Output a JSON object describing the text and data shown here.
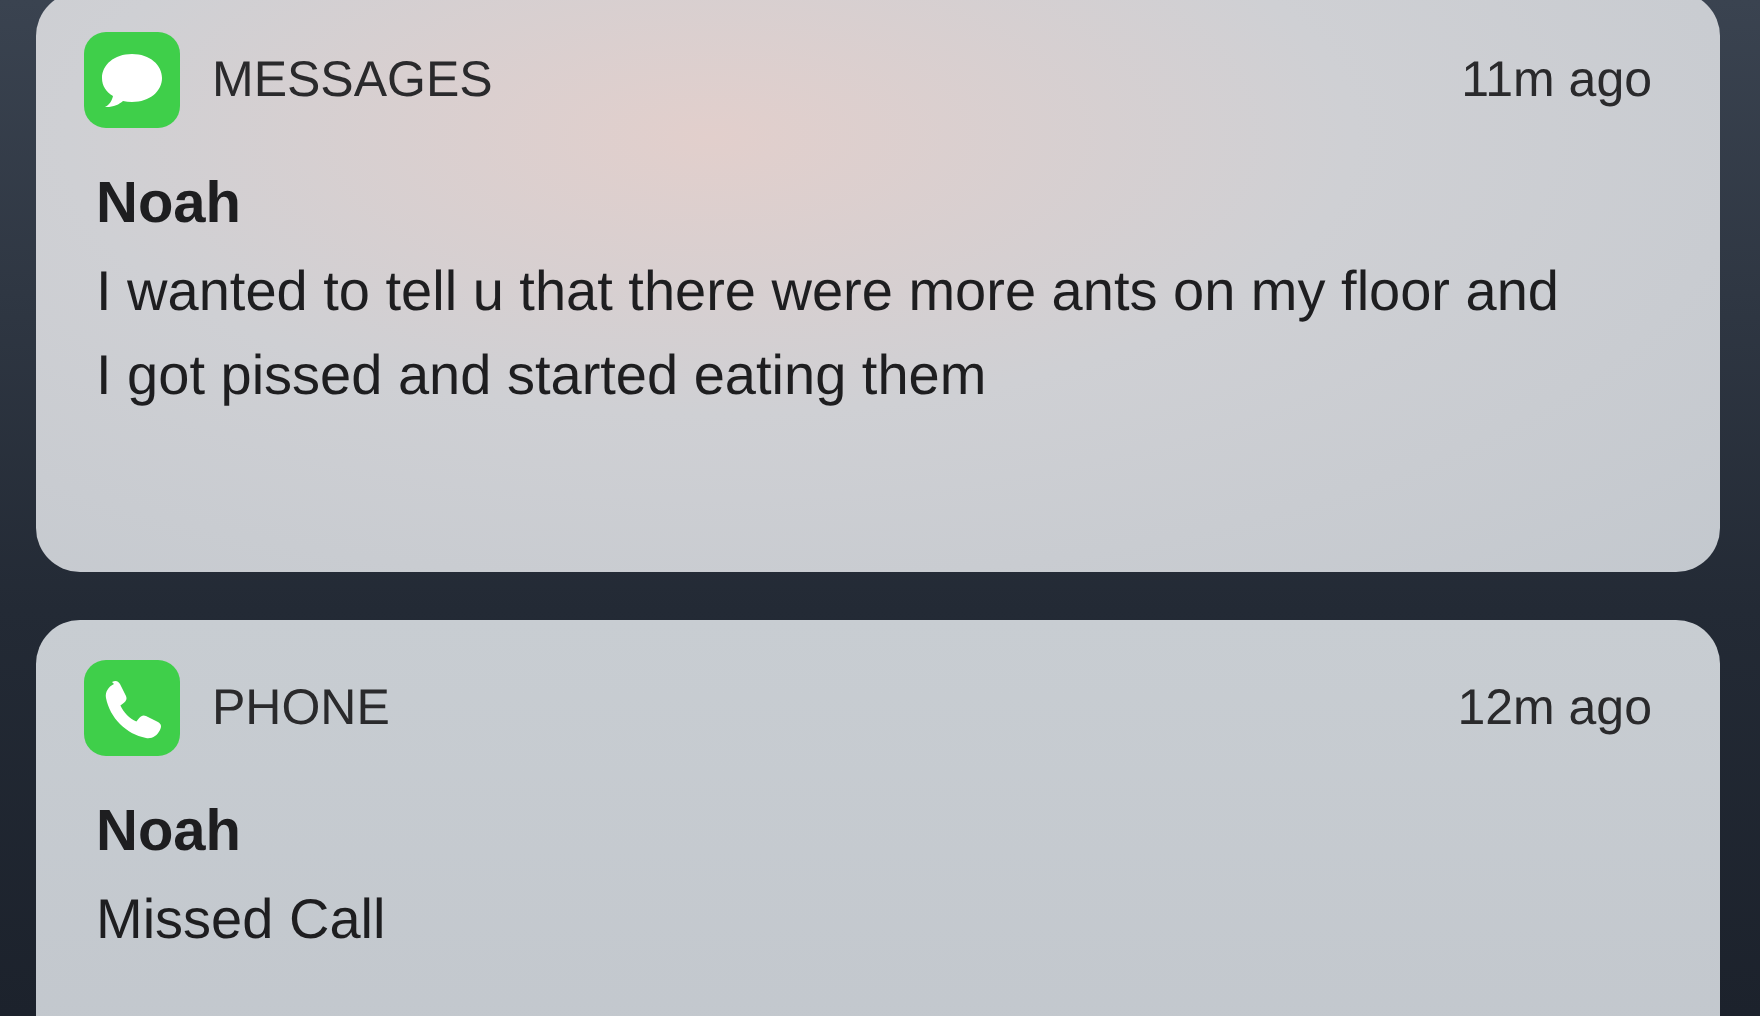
{
  "notifications": [
    {
      "app": "MESSAGES",
      "kind": "messages",
      "time": "11m ago",
      "sender": "Noah",
      "body": "I wanted to tell u that there were more ants on my floor and I got pissed and started eating them"
    },
    {
      "app": "PHONE",
      "kind": "phone",
      "time": "12m ago",
      "sender": "Noah",
      "body": "Missed Call"
    }
  ]
}
